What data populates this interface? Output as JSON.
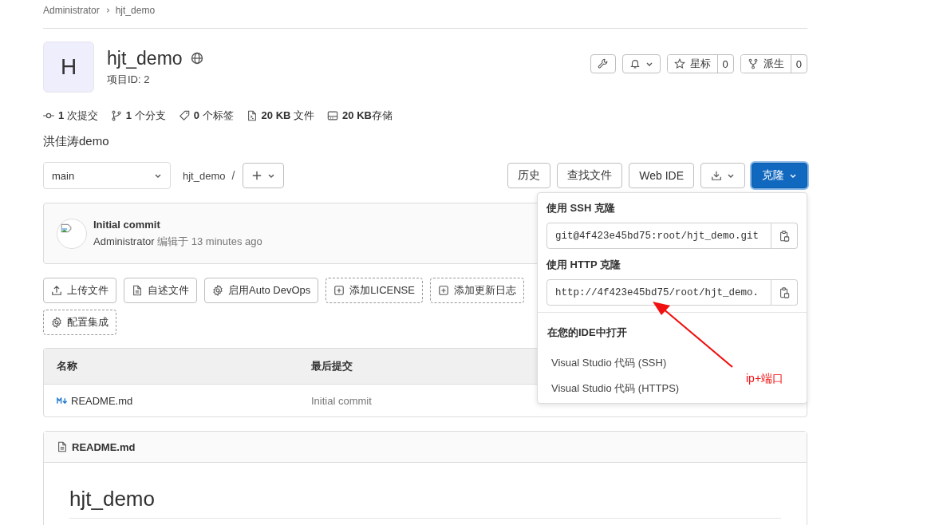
{
  "breadcrumb": [
    "Administrator",
    "hjt_demo"
  ],
  "project": {
    "avatar_letter": "H",
    "name": "hjt_demo",
    "id_label": "项目ID: 2",
    "public": true
  },
  "header_actions": {
    "star": {
      "label": "星标",
      "count": "0"
    },
    "fork": {
      "label": "派生",
      "count": "0"
    }
  },
  "stats": [
    {
      "kind": "commits",
      "text": "**1** 次提交"
    },
    {
      "kind": "branches",
      "text": "**1** 个分支"
    },
    {
      "kind": "tags",
      "text": "**0** 个标签"
    },
    {
      "kind": "files",
      "text": "**20 KB** 文件"
    },
    {
      "kind": "storage",
      "text": "**20 KB**存储"
    }
  ],
  "description": "洪佳涛demo",
  "toolbar": {
    "branch": "main",
    "path": "hjt_demo",
    "separator": "/",
    "buttons": [
      "历史",
      "查找文件",
      "Web IDE"
    ],
    "clone": {
      "label": "克隆",
      "expanded": true
    }
  },
  "clone_menu": {
    "sections": [
      {
        "title": "使用 SSH 克隆",
        "value": "git@4f423e45bd75:root/hjt_demo.git"
      },
      {
        "title": "使用 HTTP 克隆",
        "value": "http://4f423e45bd75/root/hjt_demo."
      }
    ],
    "ide_title": "在您的IDE中打开",
    "ide_items": [
      "Visual Studio 代码 (SSH)",
      "Visual Studio 代码 (HTTPS)"
    ]
  },
  "last_commit": {
    "title": "Initial commit",
    "author": "Administrator",
    "meta": "编辑于 13 minutes ago"
  },
  "quick_actions": [
    {
      "kind": "upload",
      "label": "上传文件"
    },
    {
      "kind": "readme",
      "label": "自述文件"
    },
    {
      "kind": "devops",
      "label": "启用Auto DevOps"
    },
    {
      "kind": "license",
      "label": "添加LICENSE"
    },
    {
      "kind": "changelog",
      "label": "添加更新日志"
    },
    {
      "kind": "integration",
      "label": "配置集成"
    }
  ],
  "table": {
    "columns": [
      "名称",
      "最后提交"
    ],
    "rows": [
      {
        "name": "README.md",
        "commit": "Initial commit"
      }
    ]
  },
  "readme": {
    "file": "README.md",
    "heading": "hjt_demo"
  },
  "annotation": {
    "text": "ip+端口"
  }
}
